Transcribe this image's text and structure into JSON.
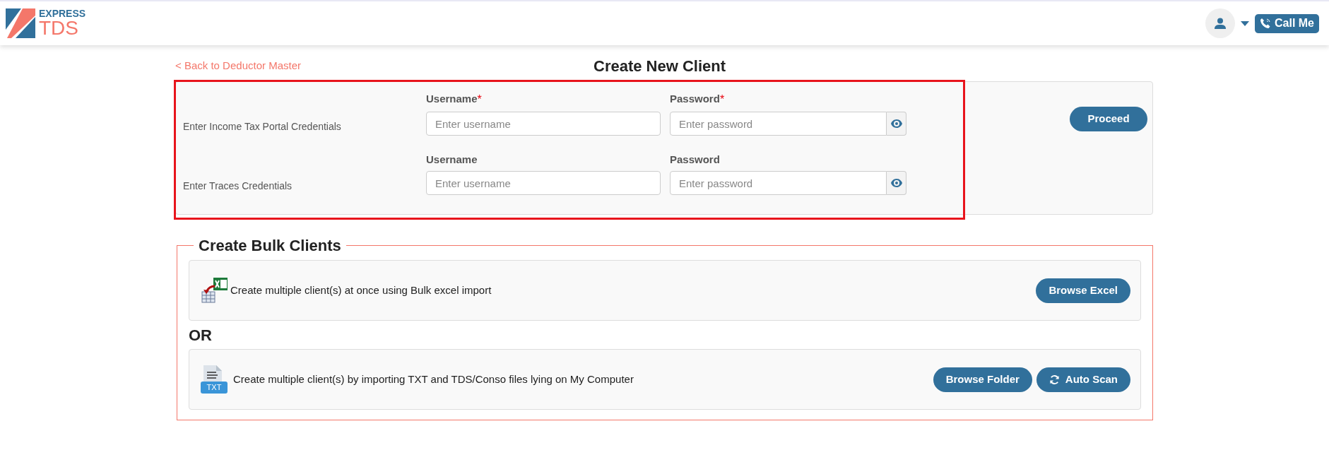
{
  "header": {
    "logo": {
      "line_1": "EXPRESS",
      "line_2": "TDS"
    },
    "call_button": "Call Me"
  },
  "back_link": "< Back to Deductor Master",
  "title": "Create New Client",
  "credentials": [
    {
      "label": "Enter Income Tax Portal Credentials",
      "username": {
        "label": "Username",
        "required_mark": "*",
        "placeholder": "Enter username"
      },
      "password": {
        "label": "Password",
        "required_mark": "*",
        "placeholder": "Enter password"
      }
    },
    {
      "label": "Enter Traces Credentials",
      "username": {
        "label": "Username",
        "placeholder": "Enter username"
      },
      "password": {
        "label": "Password",
        "placeholder": "Enter password"
      }
    }
  ],
  "proceed_button": "Proceed",
  "bulk": {
    "legend": "Create Bulk Clients",
    "separator": "OR",
    "options": [
      {
        "kind": "excel",
        "text": "Create multiple client(s) at once using Bulk excel import",
        "buttons": [
          {
            "kind": "plain",
            "label": "Browse Excel"
          }
        ]
      },
      {
        "kind": "txt",
        "text": "Create multiple client(s) by importing TXT and TDS/Conso files lying on My Computer",
        "icon_text": "TXT",
        "buttons": [
          {
            "kind": "plain",
            "label": "Browse Folder"
          },
          {
            "kind": "refresh",
            "label": "Auto Scan"
          }
        ]
      }
    ]
  }
}
